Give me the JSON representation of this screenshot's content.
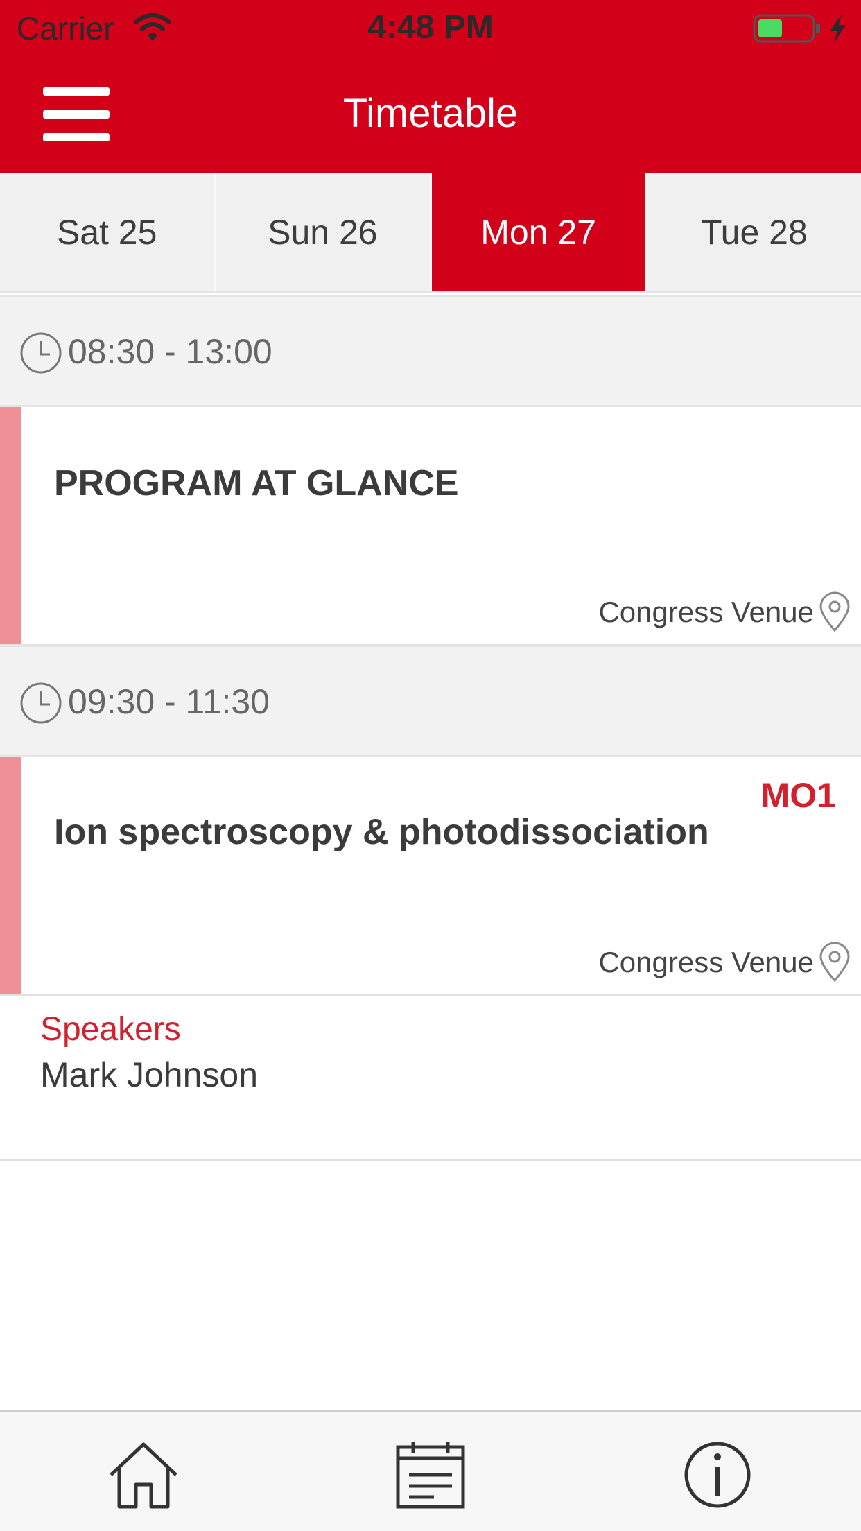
{
  "status_bar": {
    "carrier": "Carrier",
    "time": "4:48 PM",
    "battery_color": "#4cd964"
  },
  "header": {
    "title": "Timetable",
    "background_color": "#d3001a"
  },
  "day_tabs": [
    {
      "label": "Sat 25",
      "selected": false
    },
    {
      "label": "Sun 26",
      "selected": false
    },
    {
      "label": "Mon 27",
      "selected": true
    },
    {
      "label": "Tue 28",
      "selected": false
    }
  ],
  "schedule": [
    {
      "time": "08:30 - 13:00",
      "title": "PROGRAM AT GLANCE",
      "code": "",
      "venue": "Congress Venue"
    },
    {
      "time": "09:30 - 11:30",
      "title": "Ion spectroscopy  & photodissociation",
      "code": "MO1",
      "venue": "Congress Venue",
      "speakers_heading": "Speakers",
      "speakers": [
        "Mark Johnson"
      ]
    }
  ],
  "bottom_nav": [
    {
      "icon": "home-icon"
    },
    {
      "icon": "calendar-icon"
    },
    {
      "icon": "info-icon"
    }
  ]
}
